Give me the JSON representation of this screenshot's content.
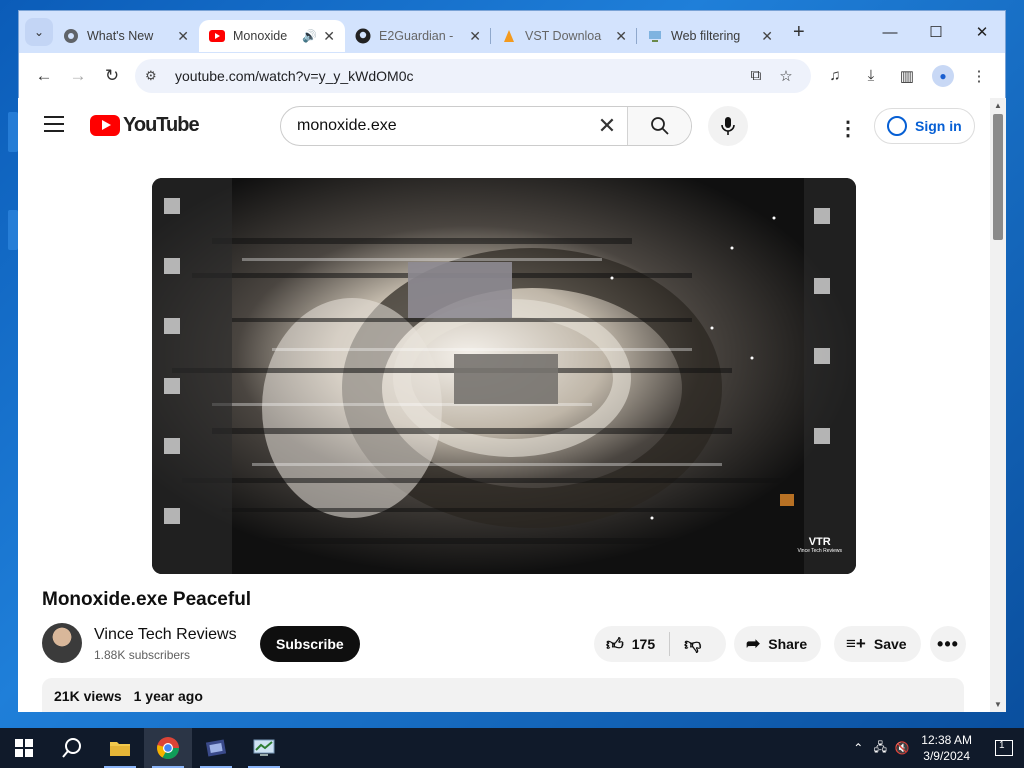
{
  "browser": {
    "tabs": [
      {
        "title": "What's New",
        "icon": "chrome-icon",
        "active": false
      },
      {
        "title": "Monoxide",
        "icon": "youtube-icon",
        "active": true,
        "audio": true
      },
      {
        "title": "E2Guardian -",
        "icon": "github-icon",
        "active": false
      },
      {
        "title": "VST Downloa",
        "icon": "fl-studio-icon",
        "active": false
      },
      {
        "title": "Web filtering",
        "icon": "network-icon",
        "active": false
      }
    ],
    "url": "youtube.com/watch?v=y_y_kWdOM0c"
  },
  "youtube": {
    "search_query": "monoxide.exe",
    "sign_in_label": "Sign in",
    "logo_text": "YouTube"
  },
  "video": {
    "title": "Monoxide.exe Peaceful",
    "watermark": "VTR",
    "watermark_sub": "Vince Tech Reviews",
    "channel_name": "Vince Tech Reviews",
    "subscribers": "1.88K subscribers",
    "subscribe_label": "Subscribe",
    "likes": "175",
    "share_label": "Share",
    "save_label": "Save",
    "views": "21K views",
    "age": "1 year ago"
  },
  "taskbar": {
    "time": "12:38 AM",
    "date": "3/9/2024",
    "notifications": "1"
  },
  "colors": {
    "youtube_red": "#ff0000",
    "link_blue": "#065fd4",
    "tabstrip": "#d3e3fd",
    "taskbar": "#101a2a"
  }
}
